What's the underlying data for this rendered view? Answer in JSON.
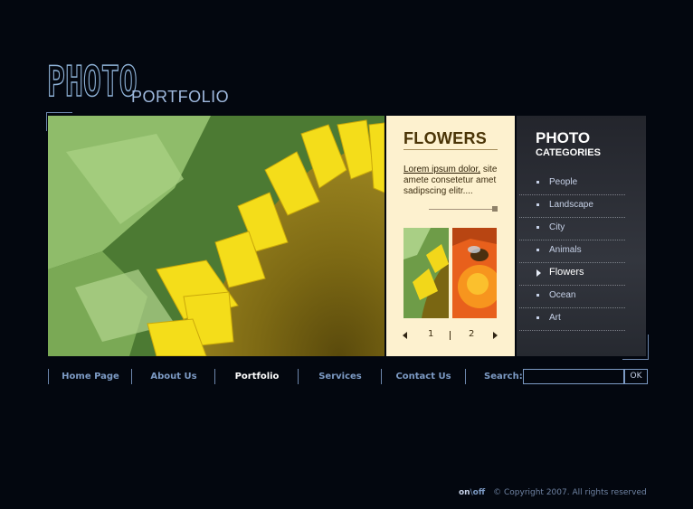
{
  "logo": {
    "photo": "PHOTO",
    "portfolio": "PORTFOLIO"
  },
  "feature": {
    "title": "FLOWERS",
    "link_text": "Lorem ipsum dolor,",
    "text": " site amete consetetur amet sadipscing elitr....",
    "pager": {
      "page1": "1",
      "page2": "2"
    }
  },
  "categories": {
    "title": "PHOTO",
    "subtitle": "CATEGORIES",
    "items": [
      {
        "label": "People"
      },
      {
        "label": "Landscape"
      },
      {
        "label": "City"
      },
      {
        "label": "Animals"
      },
      {
        "label": "Flowers"
      },
      {
        "label": "Ocean"
      },
      {
        "label": "Art"
      }
    ]
  },
  "nav": {
    "items": [
      {
        "label": "Home Page"
      },
      {
        "label": "About Us"
      },
      {
        "label": "Portfolio"
      },
      {
        "label": "Services"
      },
      {
        "label": "Contact Us"
      }
    ],
    "search_label": "Search:",
    "search_value": "",
    "search_button": "OK"
  },
  "footer": {
    "on": "on",
    "sep": "\\",
    "off": "off",
    "copyright": "© Copyright 2007. All rights reserved"
  }
}
